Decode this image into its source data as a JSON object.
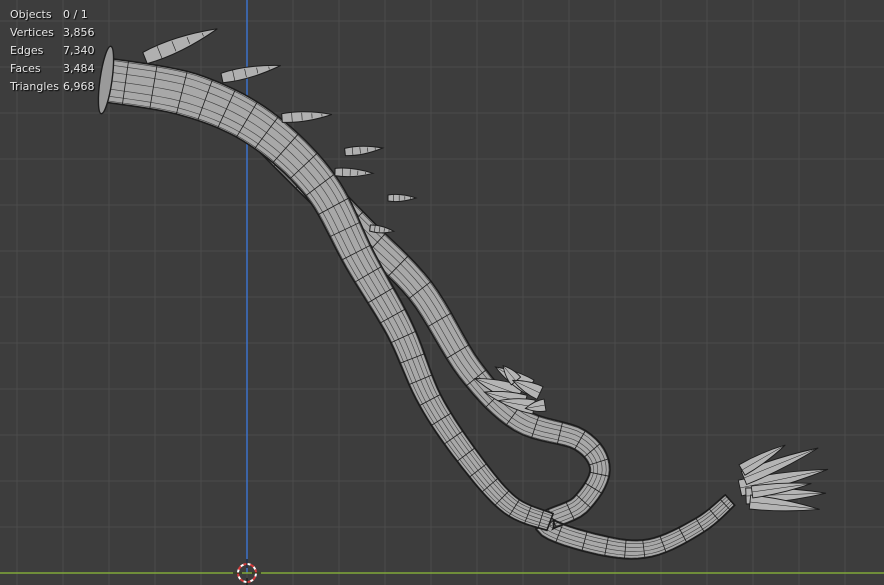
{
  "stats": {
    "objects_label": "Objects",
    "objects_value": "0 / 1",
    "vertices_label": "Vertices",
    "vertices_value": "3,856",
    "edges_label": "Edges",
    "edges_value": "7,340",
    "faces_label": "Faces",
    "faces_value": "3,484",
    "triangles_label": "Triangles",
    "triangles_value": "6,968"
  },
  "colors": {
    "background": "#3d3d3d",
    "grid": "#4b4b4b",
    "z_axis": "#3d72c9",
    "x_axis": "#80a83a",
    "mesh_fill": "#a8a8a8",
    "mesh_wire": "#1c1c1c",
    "cursor_red": "#d43b3b"
  },
  "icons": {
    "cursor": "3d-cursor-icon"
  }
}
